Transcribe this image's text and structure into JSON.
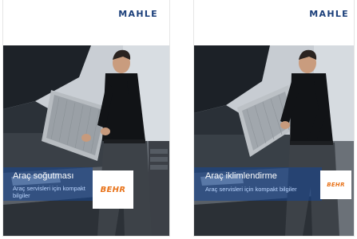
{
  "brochures": [
    {
      "brand": "MAHLE",
      "title": "Araç soğutması",
      "subtitle": "Araç servisleri için kompakt bilgiler",
      "logo": "BEHR"
    },
    {
      "brand": "MAHLE",
      "title": "Araç iklimlendirme",
      "subtitle": "Araç servisleri için kompakt bilgiler",
      "logo": "BEHR"
    }
  ],
  "colors": {
    "brand_blue": "#1b3f7a",
    "behr_orange": "#e8731a",
    "panel_blue": "#2a5fa8"
  }
}
